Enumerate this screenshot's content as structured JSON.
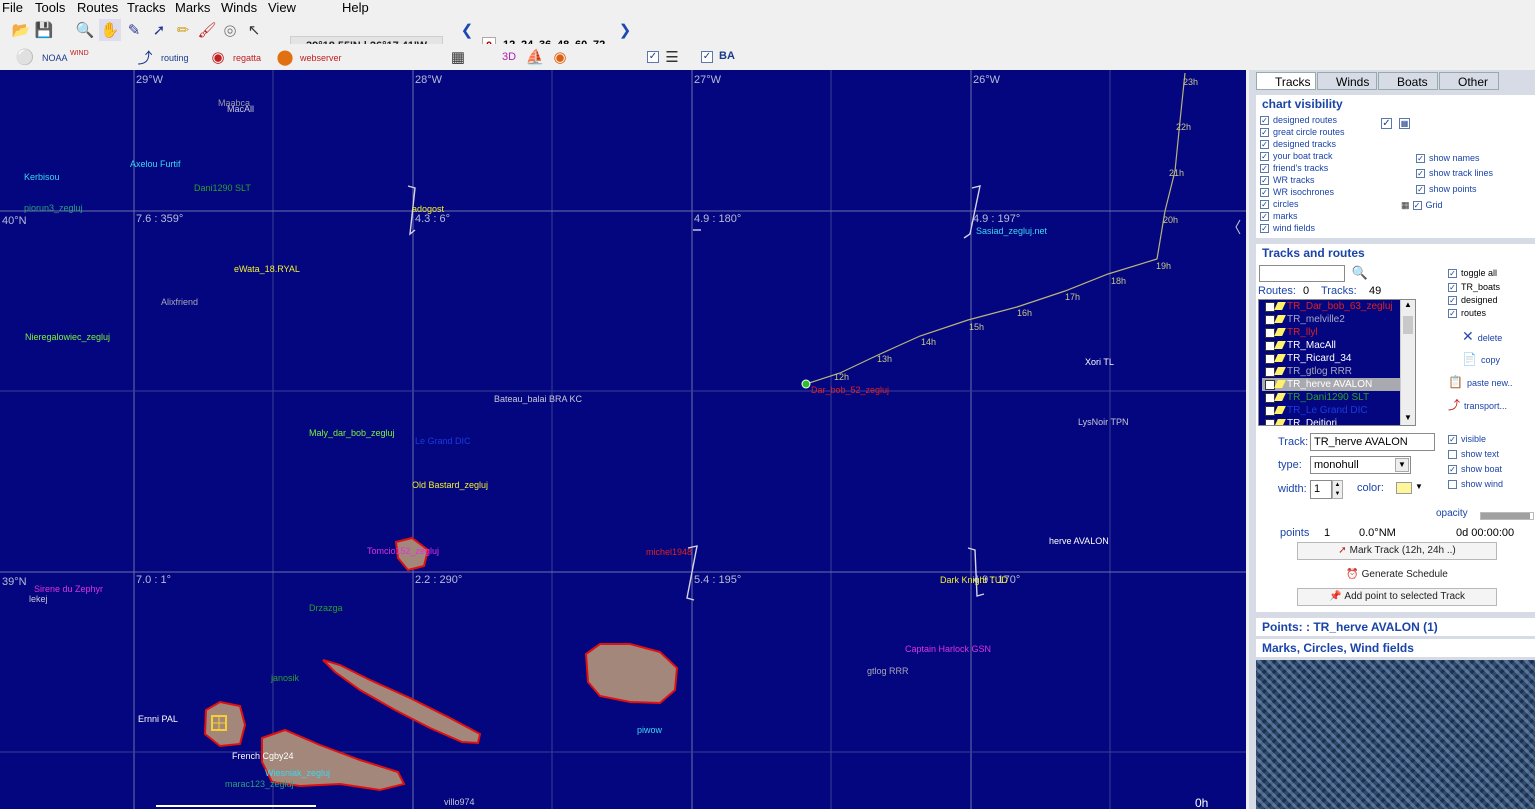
{
  "menu": [
    "File",
    "Tools",
    "Routes",
    "Tracks",
    "Marks",
    "Winds",
    "View",
    "Help"
  ],
  "toolbar": {
    "coordinates": "39°18.55'N | 26°17.41'W",
    "hours": [
      "0",
      "12",
      "24",
      "36",
      "48",
      "60",
      "72"
    ],
    "labels": {
      "noaa": "NOAA",
      "wind": "WIND",
      "routing": "routing",
      "regatta": "regatta",
      "webserver": "webserver",
      "3d": "3D",
      "ba": "BA"
    }
  },
  "map": {
    "longitude_labels": [
      "29°W",
      "28°W",
      "27°W",
      "26°W"
    ],
    "latitude_labels": [
      "40°N",
      "39°N"
    ],
    "wind_labels": [
      "7.6 : 359°",
      "4.3 : 6°",
      "4.9 : 180°",
      "4.9 : 197°",
      "7.0 : 1°",
      "2.2 : 290°",
      "5.4 : 195°",
      "4.9 : 170°"
    ],
    "time_corner": "0h",
    "boats": [
      {
        "name": "Maabca",
        "color": "#9a9aa8"
      },
      {
        "name": "MacAll",
        "color": "#c8c8d4"
      },
      {
        "name": "Kerbisou",
        "color": "#3ad8f0"
      },
      {
        "name": "Axelou Furtif",
        "color": "#3ad8f0"
      },
      {
        "name": "Dani1290 SLT",
        "color": "#2aa02a"
      },
      {
        "name": "piorun3_zegluj",
        "color": "#2aa07a"
      },
      {
        "name": "adogost",
        "color": "#f2f030"
      },
      {
        "name": "Sasiad_zegluj.net",
        "color": "#3ad8f0"
      },
      {
        "name": "eWata_18.RYAL",
        "color": "#f2f030"
      },
      {
        "name": "Alixfriend",
        "color": "#a8a8b8"
      },
      {
        "name": "Nieregalowiec_zegluj",
        "color": "#7af23a"
      },
      {
        "name": "Bateau_balai BRA KC",
        "color": "#c8c8d4"
      },
      {
        "name": "Dar_bob_52_zegluj",
        "color": "#e02020"
      },
      {
        "name": "Xori TL",
        "color": "#ffffff"
      },
      {
        "name": "Maly_dar_bob_zegluj",
        "color": "#7af23a"
      },
      {
        "name": "Le Grand DIC",
        "color": "#1a3ae0"
      },
      {
        "name": "LysNoir TPN",
        "color": "#c8c8d4"
      },
      {
        "name": "Old Bastard_zegluj",
        "color": "#f2f030"
      },
      {
        "name": "herve AVALON",
        "color": "#ffffff"
      },
      {
        "name": "Tomcio152_zegluj",
        "color": "#e030e0"
      },
      {
        "name": "michel1948",
        "color": "#e02020"
      },
      {
        "name": "Sirene du Zephyr",
        "color": "#e030e0"
      },
      {
        "name": "lekej",
        "color": "#c8c8d4"
      },
      {
        "name": "Drzazga",
        "color": "#2aa02a"
      },
      {
        "name": "Dark Knight TUD",
        "color": "#f2f030"
      },
      {
        "name": "Captain Harlock GSN",
        "color": "#e030e0"
      },
      {
        "name": "gtlog RRR",
        "color": "#a8a8b8"
      },
      {
        "name": "janosik",
        "color": "#2aa02a"
      },
      {
        "name": "Ernni PAL",
        "color": "#ffffff"
      },
      {
        "name": "piwow",
        "color": "#3ad8f0"
      },
      {
        "name": "French Cgby24",
        "color": "#ffffff"
      },
      {
        "name": "Wiesniak_zegluj",
        "color": "#3ad8f0"
      },
      {
        "name": "marac123_zegluj",
        "color": "#2aa07a"
      },
      {
        "name": "villo974",
        "color": "#c8c8d4"
      }
    ],
    "track_hours": [
      "12h",
      "13h",
      "14h",
      "15h",
      "16h",
      "17h",
      "18h",
      "19h",
      "20h",
      "21h",
      "22h",
      "23h"
    ]
  },
  "panel": {
    "tabs": [
      "Tracks",
      "Winds",
      "Boats",
      "Other"
    ],
    "chart_visibility": {
      "title": "chart visibility",
      "items": [
        "designed  routes",
        "great circle routes",
        "designed  tracks",
        "your boat track",
        "friend's tracks",
        "WR tracks",
        "WR isochrones",
        "circles",
        "marks",
        "wind fields"
      ],
      "right_items": [
        "show names",
        "show track lines",
        "show points",
        "Grid"
      ]
    },
    "tracks_routes": {
      "title": "Tracks and routes",
      "routes_label": "Routes:",
      "routes_count": "0",
      "tracks_label": "Tracks:",
      "tracks_count": "49",
      "list": [
        {
          "name": "TR_Dar_bob_63_zegluj",
          "color": "#e02020",
          "selected": false
        },
        {
          "name": "TR_melville2",
          "color": "#a8a8c8",
          "selected": false
        },
        {
          "name": "TR_llyl",
          "color": "#e02020",
          "selected": false
        },
        {
          "name": "TR_MacAll",
          "color": "#ffffff",
          "selected": false
        },
        {
          "name": "TR_Ricard_34",
          "color": "#ffffff",
          "selected": false
        },
        {
          "name": "TR_gtlog RRR",
          "color": "#a8a8b8",
          "selected": false
        },
        {
          "name": "TR_herve AVALON",
          "color": "#ffffff",
          "selected": true
        },
        {
          "name": "TR_Dani1290 SLT",
          "color": "#2aa02a",
          "selected": false
        },
        {
          "name": "TR_Le Grand DIC",
          "color": "#1a3ae0",
          "selected": false
        },
        {
          "name": "TR_Deitiori",
          "color": "#ffffff",
          "selected": false
        }
      ],
      "filters": [
        "toggle all",
        "TR_boats",
        "designed",
        "routes"
      ],
      "actions": [
        "delete",
        "copy",
        "paste new..",
        "transport..."
      ],
      "track_label": "Track:",
      "track_value": "TR_herve AVALON",
      "type_label": "type:",
      "type_value": "monohull",
      "width_label": "width:",
      "width_value": "1",
      "color_label": "color:",
      "color_value": "#fff59a",
      "options": [
        "visible",
        "show text",
        "show boat",
        "show wind"
      ],
      "opacity_label": "opacity",
      "opacity": 0.95,
      "points_label": "points",
      "points_value": "1",
      "distance": "0.0°NM",
      "duration": "0d 00:00:00",
      "mark_track": "Mark Track (12h, 24h ..)",
      "generate_schedule": "Generate Schedule",
      "add_point": "Add point to selected Track"
    },
    "points_header": "Points: : TR_herve AVALON (1)",
    "marks_header": "Marks, Circles, Wind fields"
  }
}
